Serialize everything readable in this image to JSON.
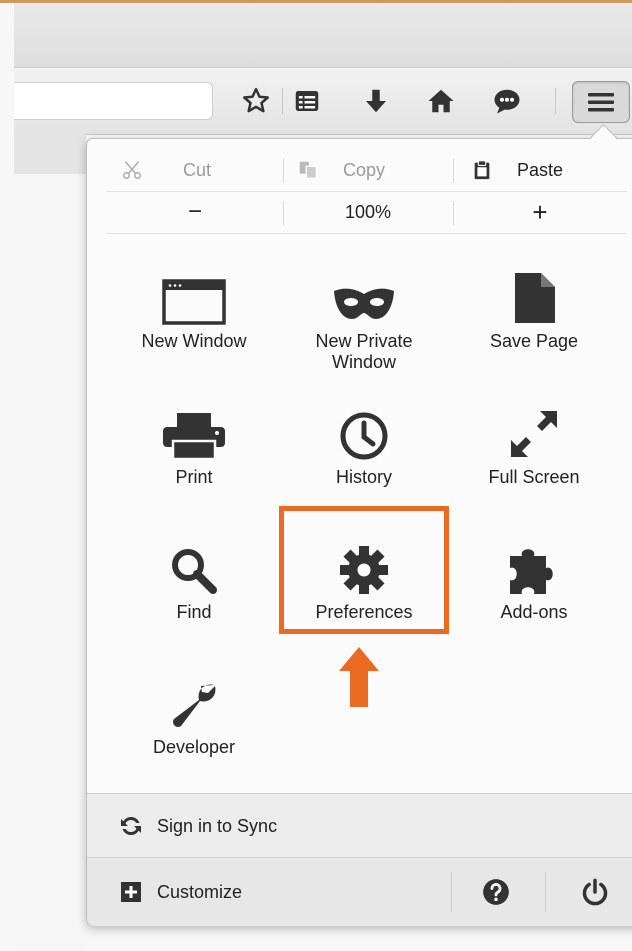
{
  "colors": {
    "highlight": "#ea6a22",
    "accent_border": "#c99a5b"
  },
  "toolbar": {
    "icons": [
      "star-icon",
      "reading-list-icon",
      "download-arrow-icon",
      "home-icon",
      "chat-icon"
    ],
    "menu_button_icon": "hamburger-menu-icon"
  },
  "edit": {
    "cut": "Cut",
    "copy": "Copy",
    "paste": "Paste"
  },
  "zoom": {
    "minus": "−",
    "level": "100%",
    "plus": "+"
  },
  "items": {
    "new_window": "New Window",
    "new_private_window_1": "New Private",
    "new_private_window_2": "Window",
    "save_page": "Save Page",
    "print": "Print",
    "history": "History",
    "full_screen": "Full Screen",
    "find": "Find",
    "preferences": "Preferences",
    "addons": "Add-ons",
    "developer": "Developer"
  },
  "footer": {
    "sync": "Sign in to Sync",
    "customize": "Customize"
  }
}
